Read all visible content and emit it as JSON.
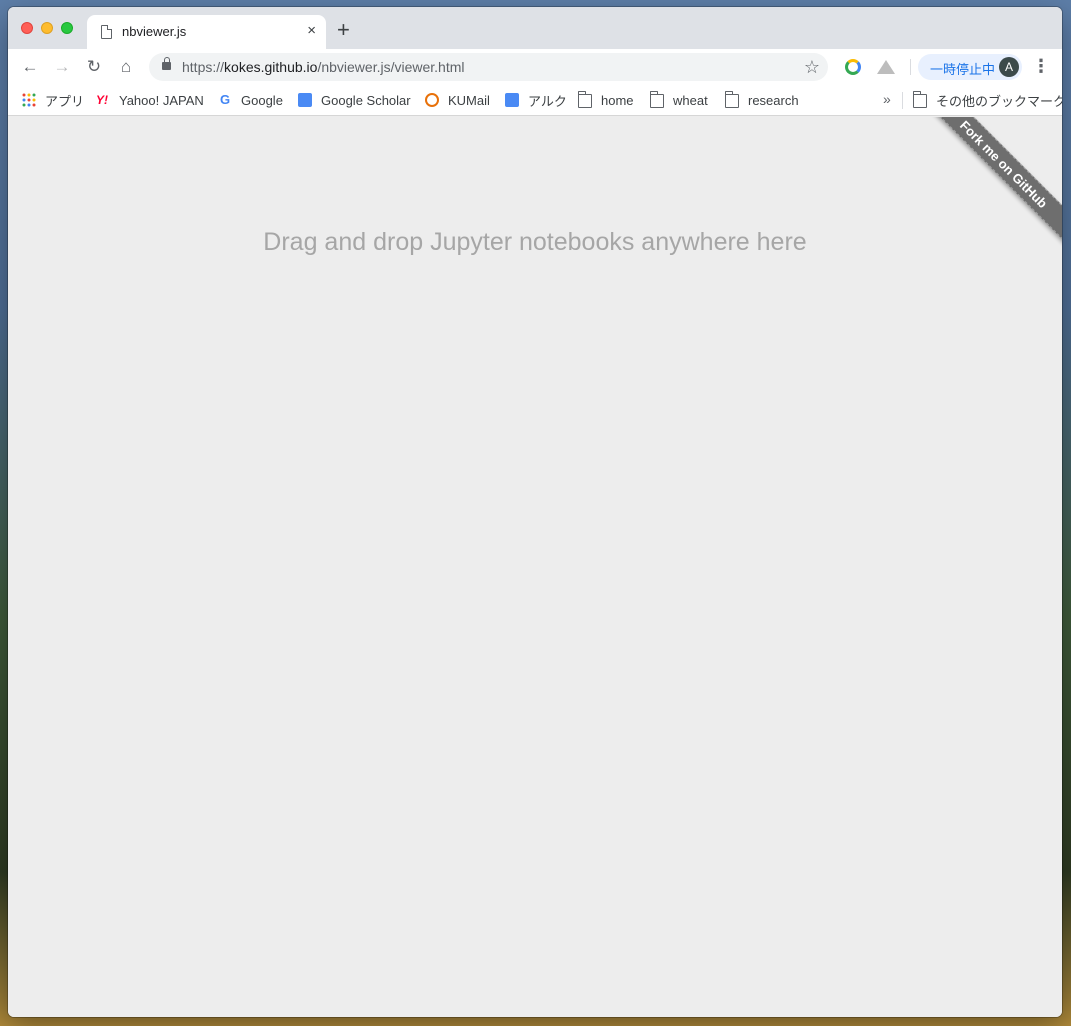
{
  "window": {
    "tab_title": "nbviewer.js",
    "tab_close": "×",
    "new_tab": "+"
  },
  "toolbar": {
    "back_icon": "←",
    "forward_icon": "→",
    "reload_icon": "↻",
    "home_icon": "⌂",
    "url_scheme": "https://",
    "url_host": "kokes.github.io",
    "url_path": "/nbviewer.js/viewer.html",
    "star_icon": "☆",
    "pause_label": "一時停止中",
    "avatar_letter": "A",
    "menu_icon": "⋮"
  },
  "bookmarks": {
    "items": [
      {
        "label": "アプリ",
        "icon": "apps-icon"
      },
      {
        "label": "Yahoo! JAPAN",
        "icon": "yahoo-icon"
      },
      {
        "label": "Google",
        "icon": "google-icon"
      },
      {
        "label": "Google Scholar",
        "icon": "scholar-icon"
      },
      {
        "label": "KUMail",
        "icon": "kumail-icon"
      },
      {
        "label": "アルク",
        "icon": "alc-icon"
      },
      {
        "label": "home",
        "icon": "folder-icon"
      },
      {
        "label": "wheat",
        "icon": "folder-icon"
      },
      {
        "label": "research",
        "icon": "folder-icon"
      }
    ],
    "more": "»",
    "other_bookmarks": "その他のブックマーク",
    "yahoo_glyph": "Y!",
    "google_glyph": "G"
  },
  "page": {
    "drop_message": "Drag and drop Jupyter notebooks anywhere here",
    "ribbon_text": "Fork me on GitHub"
  }
}
